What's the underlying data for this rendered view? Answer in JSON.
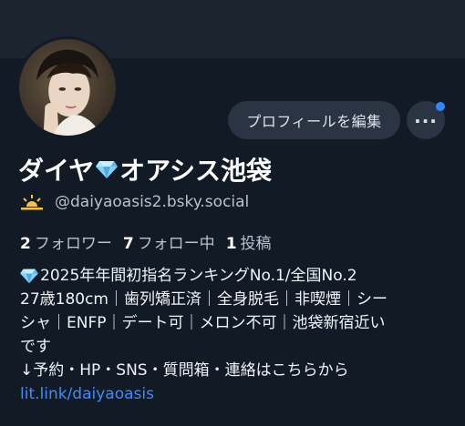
{
  "profile": {
    "name_part1": "ダイヤ",
    "name_part2": "オアシス池袋",
    "handle": "@daiyaoasis2.bsky.social",
    "followers_count": "2",
    "followers_label": "フォロワー",
    "following_count": "7",
    "following_label": "フォロー中",
    "posts_count": "1",
    "posts_label": "投稿"
  },
  "actions": {
    "edit_profile_label": "プロフィールを編集",
    "more_label": "..."
  },
  "bio": {
    "line1": "2025年年間初指名ランキングNo.1/全国No.2",
    "line2": "27歳180cm｜歯列矯正済｜全身脱毛｜非喫煙｜シー",
    "line3": "シャ｜ENFP｜デート可｜メロン不可｜池袋新宿近い",
    "line4": "です",
    "line5": "↓予約・HP・SNS・質問箱・連絡はこちらから",
    "link": "lit.link/daiyaoasis"
  },
  "icons": {
    "gem": "gem-icon",
    "sun": "sunrise-icon",
    "more": "ellipsis-icon"
  },
  "colors": {
    "background": "#121a26",
    "button_bg": "#2b3443",
    "link": "#3b8dff",
    "notify_dot": "#2f86ff"
  }
}
